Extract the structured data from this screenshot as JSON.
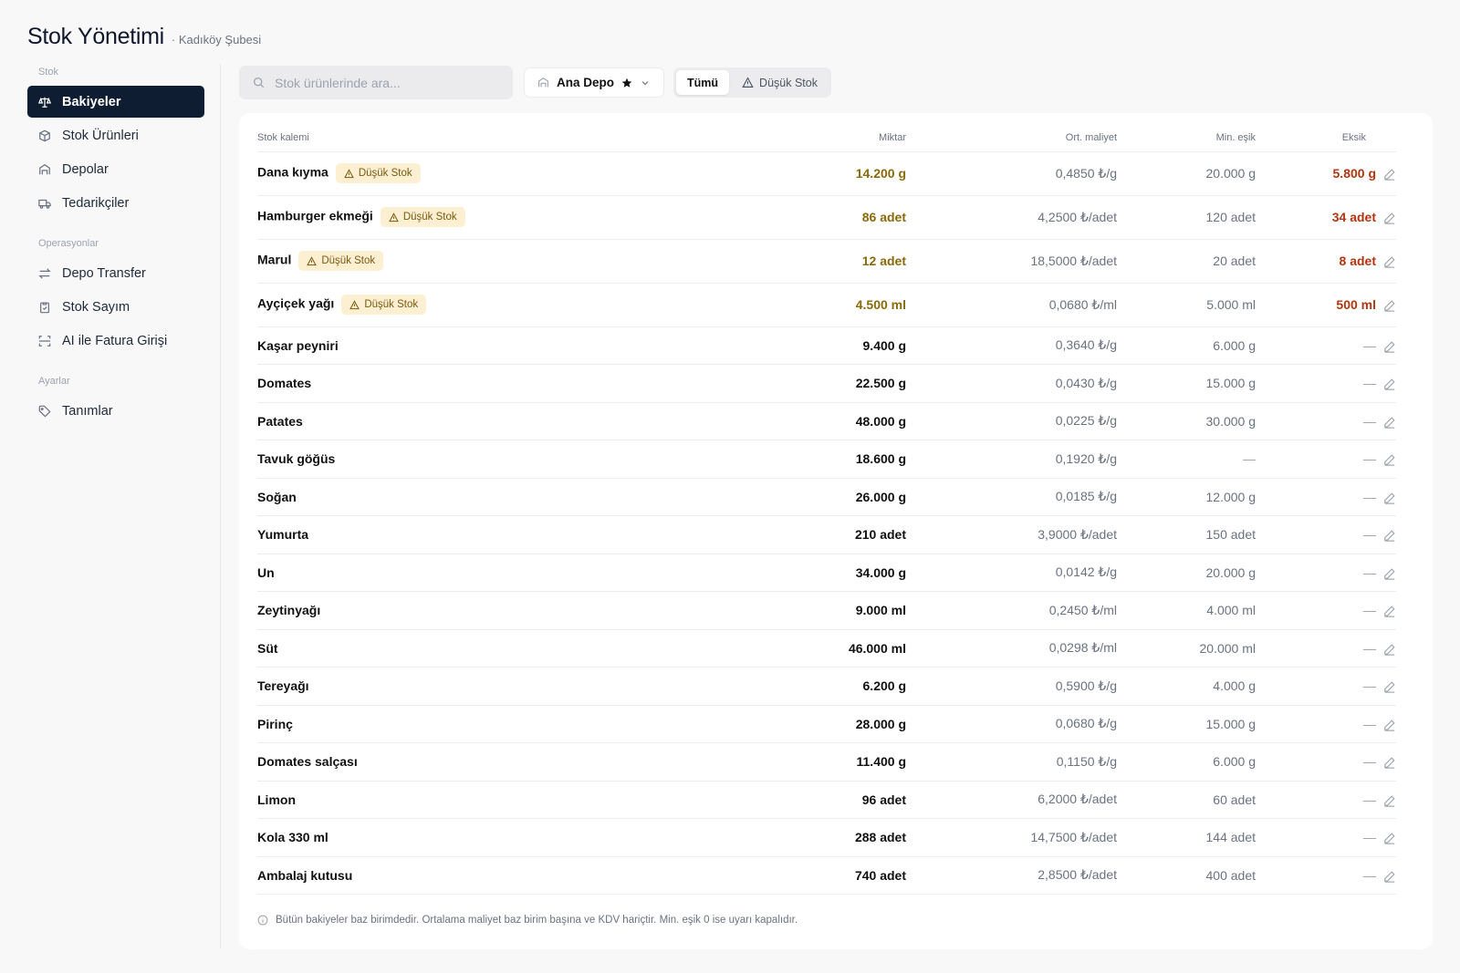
{
  "header": {
    "title": "Stok Yönetimi",
    "subtitle": "· Kadıköy Şubesi"
  },
  "sidebar": {
    "groups": [
      {
        "label": "Stok",
        "items": [
          {
            "label": "Bakiyeler",
            "icon": "scale-icon",
            "active": true
          },
          {
            "label": "Stok Ürünleri",
            "icon": "box-icon"
          },
          {
            "label": "Depolar",
            "icon": "warehouse-icon"
          },
          {
            "label": "Tedarikçiler",
            "icon": "truck-icon"
          }
        ]
      },
      {
        "label": "Operasyonlar",
        "items": [
          {
            "label": "Depo Transfer",
            "icon": "transfer-icon"
          },
          {
            "label": "Stok Sayım",
            "icon": "clipboard-icon"
          },
          {
            "label": "AI ile Fatura Girişi",
            "icon": "scan-icon"
          }
        ]
      },
      {
        "label": "Ayarlar",
        "items": [
          {
            "label": "Tanımlar",
            "icon": "tag-icon"
          }
        ]
      }
    ]
  },
  "toolbar": {
    "search_placeholder": "Stok ürünlerinde ara...",
    "warehouse": "Ana Depo",
    "filters": [
      {
        "label": "Tümü",
        "active": true
      },
      {
        "label": "Düşük Stok",
        "active": false
      }
    ]
  },
  "table": {
    "columns": [
      "Stok kalemi",
      "Miktar",
      "Ort. maliyet",
      "Min. eşik",
      "Eksik"
    ],
    "low_badge": "Düşük Stok",
    "rows": [
      {
        "name": "Dana kıyma",
        "low": true,
        "qty": "14.200 g",
        "cost": "0,4850 ₺/g",
        "min": "20.000 g",
        "missing": "5.800 g"
      },
      {
        "name": "Hamburger ekmeği",
        "low": true,
        "qty": "86 adet",
        "cost": "4,2500 ₺/adet",
        "min": "120 adet",
        "missing": "34 adet"
      },
      {
        "name": "Marul",
        "low": true,
        "qty": "12 adet",
        "cost": "18,5000 ₺/adet",
        "min": "20 adet",
        "missing": "8 adet"
      },
      {
        "name": "Ayçiçek yağı",
        "low": true,
        "qty": "4.500 ml",
        "cost": "0,0680 ₺/ml",
        "min": "5.000 ml",
        "missing": "500 ml"
      },
      {
        "name": "Kaşar peyniri",
        "low": false,
        "qty": "9.400 g",
        "cost": "0,3640 ₺/g",
        "min": "6.000 g",
        "missing": "—"
      },
      {
        "name": "Domates",
        "low": false,
        "qty": "22.500 g",
        "cost": "0,0430 ₺/g",
        "min": "15.000 g",
        "missing": "—"
      },
      {
        "name": "Patates",
        "low": false,
        "qty": "48.000 g",
        "cost": "0,0225 ₺/g",
        "min": "30.000 g",
        "missing": "—"
      },
      {
        "name": "Tavuk göğüs",
        "low": false,
        "qty": "18.600 g",
        "cost": "0,1920 ₺/g",
        "min": "—",
        "missing": "—"
      },
      {
        "name": "Soğan",
        "low": false,
        "qty": "26.000 g",
        "cost": "0,0185 ₺/g",
        "min": "12.000 g",
        "missing": "—"
      },
      {
        "name": "Yumurta",
        "low": false,
        "qty": "210 adet",
        "cost": "3,9000 ₺/adet",
        "min": "150 adet",
        "missing": "—"
      },
      {
        "name": "Un",
        "low": false,
        "qty": "34.000 g",
        "cost": "0,0142 ₺/g",
        "min": "20.000 g",
        "missing": "—"
      },
      {
        "name": "Zeytinyağı",
        "low": false,
        "qty": "9.000 ml",
        "cost": "0,2450 ₺/ml",
        "min": "4.000 ml",
        "missing": "—"
      },
      {
        "name": "Süt",
        "low": false,
        "qty": "46.000 ml",
        "cost": "0,0298 ₺/ml",
        "min": "20.000 ml",
        "missing": "—"
      },
      {
        "name": "Tereyağı",
        "low": false,
        "qty": "6.200 g",
        "cost": "0,5900 ₺/g",
        "min": "4.000 g",
        "missing": "—"
      },
      {
        "name": "Pirinç",
        "low": false,
        "qty": "28.000 g",
        "cost": "0,0680 ₺/g",
        "min": "15.000 g",
        "missing": "—"
      },
      {
        "name": "Domates salçası",
        "low": false,
        "qty": "11.400 g",
        "cost": "0,1150 ₺/g",
        "min": "6.000 g",
        "missing": "—"
      },
      {
        "name": "Limon",
        "low": false,
        "qty": "96 adet",
        "cost": "6,2000 ₺/adet",
        "min": "60 adet",
        "missing": "—"
      },
      {
        "name": "Kola 330 ml",
        "low": false,
        "qty": "288 adet",
        "cost": "14,7500 ₺/adet",
        "min": "144 adet",
        "missing": "—"
      },
      {
        "name": "Ambalaj kutusu",
        "low": false,
        "qty": "740 adet",
        "cost": "2,8500 ₺/adet",
        "min": "400 adet",
        "missing": "—"
      }
    ]
  },
  "footnote": "Bütün bakiyeler baz birimdedir. Ortalama maliyet baz birim başına ve KDV hariçtir. Min. eşik 0 ise uyarı kapalıdır.",
  "colors": {
    "accent": "#0f1d33",
    "warn_text": "#8a6a0a",
    "warn_bg": "#fcefd2",
    "danger": "#b3350f"
  }
}
